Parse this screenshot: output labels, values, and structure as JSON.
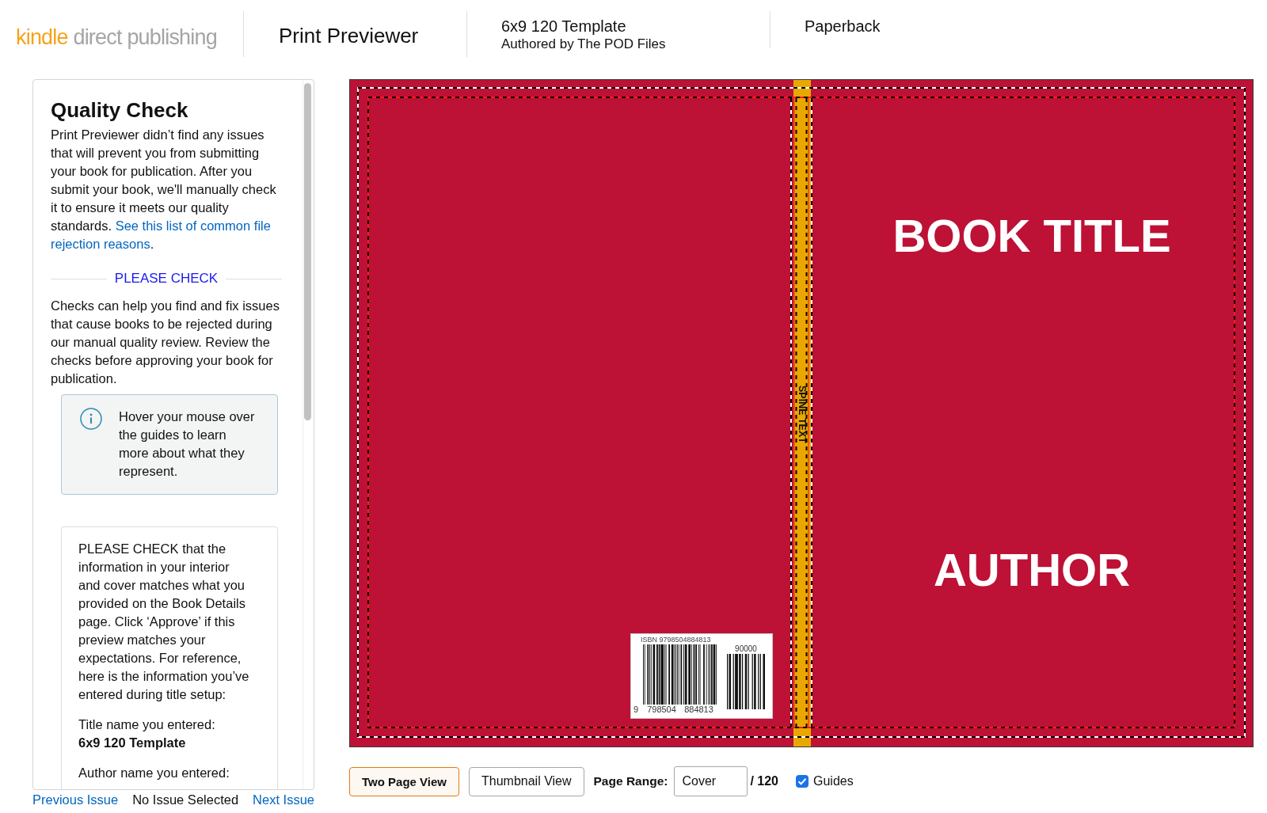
{
  "header": {
    "logo": {
      "primary": "kindle",
      "secondary": "direct publishing"
    },
    "app_title": "Print Previewer",
    "book": {
      "title": "6x9 120 Template",
      "byline": "Authored by The POD Files"
    },
    "format": "Paperback"
  },
  "quality_panel": {
    "title": "Quality Check",
    "intro": "Print Previewer didn’t find any issues that will prevent you from submitting your book for publication. After you submit your book, we'll manually check it to ensure it meets our quality standards.",
    "intro_link": [
      "See this list of common file",
      "rejection reasons"
    ],
    "intro_after": ".",
    "section_heading": "PLEASE CHECK",
    "section_text": "Checks can help you find and fix issues that cause books to be rejected during our manual quality review. Review the checks before approving your book for publication.",
    "info_note": "Hover your mouse over the guides to learn more about what they represent.",
    "check_card": {
      "text": "PLEASE CHECK that the information in your interior and cover matches what you provided on the Book Details page. Click ‘Approve’ if this preview matches your expectations. For reference, here is the information you’ve entered during title setup:",
      "fields": [
        {
          "label": "Title name you entered:",
          "value": "6x9 120 Template"
        },
        {
          "label": "Author name you entered:"
        }
      ]
    }
  },
  "issue_nav": {
    "previous": "Previous Issue",
    "status": "No Issue Selected",
    "next": "Next Issue"
  },
  "cover": {
    "title": "BOOK TITLE",
    "author": "AUTHOR",
    "spine_text": "SPINE TEXT",
    "barcode": {
      "isbn": "ISBN 9798504884813",
      "price_code": "90000",
      "digits": [
        "9",
        "798504",
        "884813"
      ]
    }
  },
  "toolbar": {
    "views": [
      {
        "label": "Two Page View",
        "selected": true
      },
      {
        "label": "Thumbnail View",
        "selected": false
      }
    ],
    "page_range": {
      "label": "Page Range:",
      "value": "Cover",
      "total": "/ 120"
    },
    "guides": {
      "label": "Guides",
      "checked": true
    }
  }
}
